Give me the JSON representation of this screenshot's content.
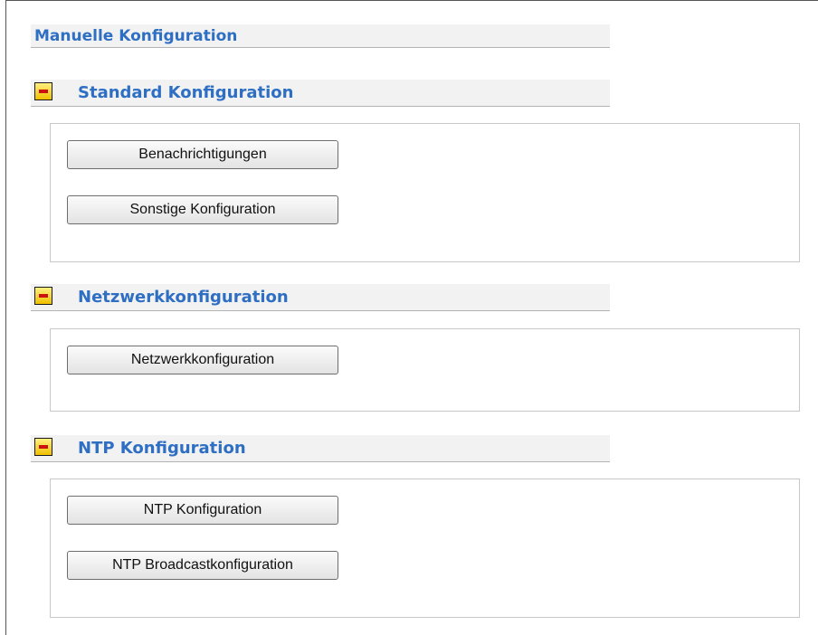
{
  "page": {
    "title": "Manuelle Konfiguration"
  },
  "sections": [
    {
      "title": "Standard Konfiguration",
      "toggle_icon": "collapse-minus-icon",
      "buttons": [
        "Benachrichtigungen",
        "Sonstige Konfiguration"
      ]
    },
    {
      "title": "Netzwerkkonfiguration",
      "toggle_icon": "collapse-minus-icon",
      "buttons": [
        "Netzwerkkonfiguration"
      ]
    },
    {
      "title": "NTP Konfiguration",
      "toggle_icon": "collapse-minus-icon",
      "buttons": [
        "NTP Konfiguration",
        "NTP Broadcastkonfiguration"
      ]
    }
  ],
  "colors": {
    "heading": "#2e6fc4",
    "header_bg": "#f2f2f2",
    "toggle_fill": "#f0c000",
    "toggle_bar": "#cc1010"
  }
}
